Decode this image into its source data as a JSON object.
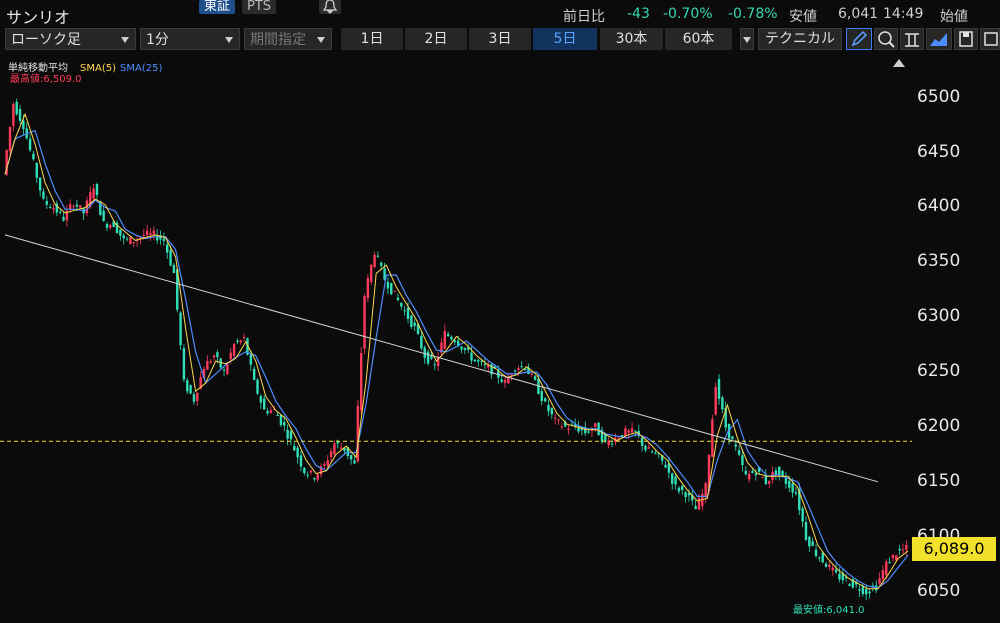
{
  "header": {
    "title": "サンリオ",
    "segments": [
      "東証",
      "PTS"
    ],
    "quote": {
      "change_label": "前日比",
      "change": "-43",
      "change_pct": "-0.70%",
      "low_pct": "-0.78%",
      "low_label": "安値",
      "low_value": "6,041",
      "time": "14:49",
      "open_label": "始値"
    }
  },
  "toolbar": {
    "chart_type": "ローソク足",
    "interval": "1分",
    "period": "期間指定",
    "ranges": [
      "1日",
      "2日",
      "3日",
      "5日",
      "30本",
      "60本"
    ],
    "active_range": "5日",
    "technical": "テクニカル"
  },
  "colors": {
    "up": "#ff3b5c",
    "down": "#2fe0b8",
    "sma5": "#ffd84d",
    "sma25": "#4d8dff",
    "trend": "#d8d8d8",
    "ref_line": "#f2e12b"
  },
  "chart_data": {
    "type": "line",
    "indicator_label": "単純移動平均",
    "series": [
      {
        "name": "SMA(5)"
      },
      {
        "name": "SMA(25)"
      }
    ],
    "x": [
      0,
      10,
      20,
      30,
      40,
      50,
      60,
      70,
      80,
      90,
      100,
      110,
      120,
      130,
      140,
      150,
      160,
      170,
      180,
      190,
      200,
      210,
      220,
      230,
      240,
      250,
      260,
      270,
      280,
      290,
      300,
      310,
      320,
      330,
      340,
      350,
      360,
      370,
      380,
      390,
      400,
      410,
      420,
      430,
      440,
      450,
      460,
      470,
      480,
      490,
      500,
      510,
      520,
      530,
      540,
      550,
      560,
      570,
      580,
      590,
      600,
      610,
      620,
      630,
      640,
      650,
      660,
      670,
      680,
      690,
      700,
      710,
      720,
      730,
      740,
      750,
      760,
      770,
      780,
      790,
      800,
      810,
      820,
      830,
      840,
      850,
      860,
      870,
      880,
      890,
      900
    ],
    "close": [
      6430,
      6495,
      6475,
      6440,
      6405,
      6400,
      6390,
      6405,
      6395,
      6420,
      6385,
      6385,
      6370,
      6370,
      6375,
      6375,
      6370,
      6340,
      6240,
      6225,
      6255,
      6265,
      6250,
      6275,
      6280,
      6240,
      6215,
      6215,
      6200,
      6180,
      6160,
      6155,
      6165,
      6185,
      6180,
      6165,
      6320,
      6360,
      6335,
      6320,
      6305,
      6290,
      6265,
      6255,
      6285,
      6280,
      6270,
      6260,
      6255,
      6250,
      6240,
      6255,
      6255,
      6240,
      6220,
      6205,
      6200,
      6200,
      6195,
      6200,
      6185,
      6190,
      6195,
      6195,
      6180,
      6175,
      6165,
      6145,
      6140,
      6125,
      6145,
      6240,
      6200,
      6180,
      6155,
      6160,
      6150,
      6160,
      6150,
      6140,
      6100,
      6085,
      6075,
      6065,
      6060,
      6055,
      6050,
      6055,
      6075,
      6085,
      6089
    ],
    "high_marker": {
      "label": "最高値:6,509.0"
    },
    "low_marker": {
      "label": "最安値:6,041.0"
    },
    "trendline": {
      "from": [
        0,
        6375
      ],
      "to": [
        870,
        6150
      ]
    },
    "ref_line": 6187,
    "last_price": "6,089.0",
    "yticks": [
      "6500",
      "6450",
      "6400",
      "6350",
      "6300",
      "6250",
      "6200",
      "6150",
      "6100",
      "6050"
    ],
    "ylim": [
      6025,
      6538
    ]
  }
}
